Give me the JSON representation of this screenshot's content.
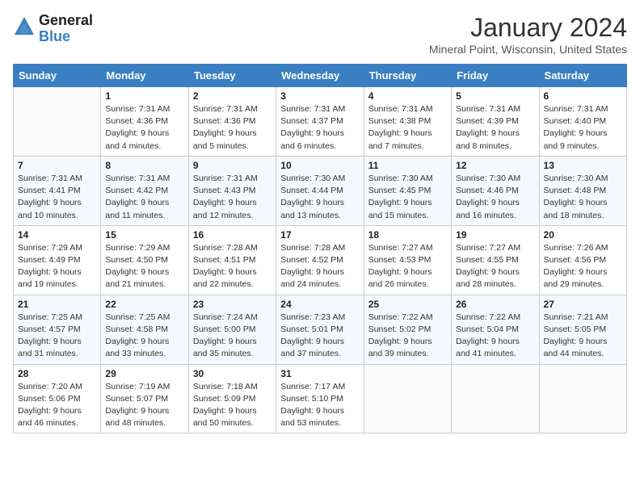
{
  "logo": {
    "general": "General",
    "blue": "Blue"
  },
  "header": {
    "month_year": "January 2024",
    "location": "Mineral Point, Wisconsin, United States"
  },
  "days_of_week": [
    "Sunday",
    "Monday",
    "Tuesday",
    "Wednesday",
    "Thursday",
    "Friday",
    "Saturday"
  ],
  "weeks": [
    [
      {
        "day": "",
        "info": ""
      },
      {
        "day": "1",
        "info": "Sunrise: 7:31 AM\nSunset: 4:36 PM\nDaylight: 9 hours\nand 4 minutes."
      },
      {
        "day": "2",
        "info": "Sunrise: 7:31 AM\nSunset: 4:36 PM\nDaylight: 9 hours\nand 5 minutes."
      },
      {
        "day": "3",
        "info": "Sunrise: 7:31 AM\nSunset: 4:37 PM\nDaylight: 9 hours\nand 6 minutes."
      },
      {
        "day": "4",
        "info": "Sunrise: 7:31 AM\nSunset: 4:38 PM\nDaylight: 9 hours\nand 7 minutes."
      },
      {
        "day": "5",
        "info": "Sunrise: 7:31 AM\nSunset: 4:39 PM\nDaylight: 9 hours\nand 8 minutes."
      },
      {
        "day": "6",
        "info": "Sunrise: 7:31 AM\nSunset: 4:40 PM\nDaylight: 9 hours\nand 9 minutes."
      }
    ],
    [
      {
        "day": "7",
        "info": "Sunrise: 7:31 AM\nSunset: 4:41 PM\nDaylight: 9 hours\nand 10 minutes."
      },
      {
        "day": "8",
        "info": "Sunrise: 7:31 AM\nSunset: 4:42 PM\nDaylight: 9 hours\nand 11 minutes."
      },
      {
        "day": "9",
        "info": "Sunrise: 7:31 AM\nSunset: 4:43 PM\nDaylight: 9 hours\nand 12 minutes."
      },
      {
        "day": "10",
        "info": "Sunrise: 7:30 AM\nSunset: 4:44 PM\nDaylight: 9 hours\nand 13 minutes."
      },
      {
        "day": "11",
        "info": "Sunrise: 7:30 AM\nSunset: 4:45 PM\nDaylight: 9 hours\nand 15 minutes."
      },
      {
        "day": "12",
        "info": "Sunrise: 7:30 AM\nSunset: 4:46 PM\nDaylight: 9 hours\nand 16 minutes."
      },
      {
        "day": "13",
        "info": "Sunrise: 7:30 AM\nSunset: 4:48 PM\nDaylight: 9 hours\nand 18 minutes."
      }
    ],
    [
      {
        "day": "14",
        "info": "Sunrise: 7:29 AM\nSunset: 4:49 PM\nDaylight: 9 hours\nand 19 minutes."
      },
      {
        "day": "15",
        "info": "Sunrise: 7:29 AM\nSunset: 4:50 PM\nDaylight: 9 hours\nand 21 minutes."
      },
      {
        "day": "16",
        "info": "Sunrise: 7:28 AM\nSunset: 4:51 PM\nDaylight: 9 hours\nand 22 minutes."
      },
      {
        "day": "17",
        "info": "Sunrise: 7:28 AM\nSunset: 4:52 PM\nDaylight: 9 hours\nand 24 minutes."
      },
      {
        "day": "18",
        "info": "Sunrise: 7:27 AM\nSunset: 4:53 PM\nDaylight: 9 hours\nand 26 minutes."
      },
      {
        "day": "19",
        "info": "Sunrise: 7:27 AM\nSunset: 4:55 PM\nDaylight: 9 hours\nand 28 minutes."
      },
      {
        "day": "20",
        "info": "Sunrise: 7:26 AM\nSunset: 4:56 PM\nDaylight: 9 hours\nand 29 minutes."
      }
    ],
    [
      {
        "day": "21",
        "info": "Sunrise: 7:25 AM\nSunset: 4:57 PM\nDaylight: 9 hours\nand 31 minutes."
      },
      {
        "day": "22",
        "info": "Sunrise: 7:25 AM\nSunset: 4:58 PM\nDaylight: 9 hours\nand 33 minutes."
      },
      {
        "day": "23",
        "info": "Sunrise: 7:24 AM\nSunset: 5:00 PM\nDaylight: 9 hours\nand 35 minutes."
      },
      {
        "day": "24",
        "info": "Sunrise: 7:23 AM\nSunset: 5:01 PM\nDaylight: 9 hours\nand 37 minutes."
      },
      {
        "day": "25",
        "info": "Sunrise: 7:22 AM\nSunset: 5:02 PM\nDaylight: 9 hours\nand 39 minutes."
      },
      {
        "day": "26",
        "info": "Sunrise: 7:22 AM\nSunset: 5:04 PM\nDaylight: 9 hours\nand 41 minutes."
      },
      {
        "day": "27",
        "info": "Sunrise: 7:21 AM\nSunset: 5:05 PM\nDaylight: 9 hours\nand 44 minutes."
      }
    ],
    [
      {
        "day": "28",
        "info": "Sunrise: 7:20 AM\nSunset: 5:06 PM\nDaylight: 9 hours\nand 46 minutes."
      },
      {
        "day": "29",
        "info": "Sunrise: 7:19 AM\nSunset: 5:07 PM\nDaylight: 9 hours\nand 48 minutes."
      },
      {
        "day": "30",
        "info": "Sunrise: 7:18 AM\nSunset: 5:09 PM\nDaylight: 9 hours\nand 50 minutes."
      },
      {
        "day": "31",
        "info": "Sunrise: 7:17 AM\nSunset: 5:10 PM\nDaylight: 9 hours\nand 53 minutes."
      },
      {
        "day": "",
        "info": ""
      },
      {
        "day": "",
        "info": ""
      },
      {
        "day": "",
        "info": ""
      }
    ]
  ]
}
